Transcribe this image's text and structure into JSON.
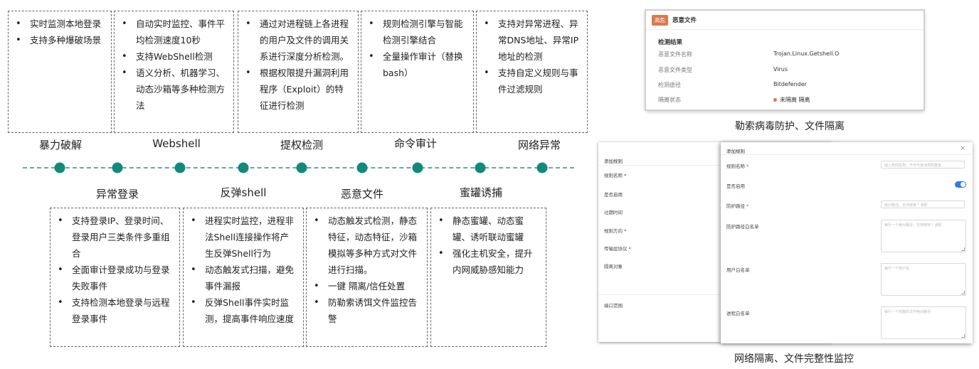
{
  "timeline_top": {
    "labels": [
      "暴力破解",
      "Webshell",
      "提权检测",
      "命令审计",
      "网络异常"
    ],
    "boxes": [
      [
        "实时监测本地登录",
        "支持多种爆破场景"
      ],
      [
        "自动实时监控、事件平均检测速度10秒",
        "支持WebShell检测",
        "语义分析、机器学习、动态沙箱等多种检测方法"
      ],
      [
        "通过对进程链上各进程的用户及文件的调用关系进行深度分析检测。",
        "根据权限提升漏洞利用程序（Exploit）的特征进行检测"
      ],
      [
        "规则检测引擎与智能检测引擎结合",
        "全量操作审计（替换bash）"
      ],
      [
        "支持对异常进程、异常DNS地址、异常IP地址的检测",
        "支持自定义规则与事件过滤规则"
      ]
    ]
  },
  "timeline_bottom": {
    "labels": [
      "异常登录",
      "反弹shell",
      "恶意文件",
      "蜜罐诱捕"
    ],
    "boxes": [
      [
        "支持登录IP、登录时间、登录用户三类条件多重组合",
        "全面审计登录成功与登录失败事件",
        "支持检测本地登录与远程登录事件"
      ],
      [
        "进程实时监控，进程非法Shell连接操作将产生反弹Shell行为",
        "动态触发式扫描，避免事件漏报",
        "反弹Shell事件实时监测，提高事件响应速度"
      ],
      [
        "动态触发式检测，静态特征，动态特征，沙箱模拟等多种方式对文件进行扫描。",
        "一键 隔离/信任处置",
        "防勒索诱饵文件监控告警"
      ],
      [
        "静态蜜罐、动态蜜罐、诱听联动蜜罐",
        "强化主机安全，提升内网威胁感知能力"
      ]
    ]
  },
  "malware_panel": {
    "badge": "高危",
    "title": "恶意文件",
    "section": "检测结果",
    "rows": [
      {
        "label": "恶意文件名称",
        "value": "Trojan.Linux.Getshell.O"
      },
      {
        "label": "恶意文件类型",
        "value": "Virus"
      },
      {
        "label": "检测途径",
        "value": "Bitdefender"
      },
      {
        "label": "隔离状态",
        "value": "未隔离  隔离"
      }
    ],
    "caption": "勒索病毒防护、文件隔离"
  },
  "rule_dialog": {
    "back_title": "添加规则",
    "back_fields": [
      "规则名称 *",
      "是否启用",
      "过期时间",
      "规则方向 *",
      "传输层协议 *",
      "隔离对象",
      "端口范围"
    ],
    "front_title": "添加规则",
    "close": "×",
    "fields": [
      {
        "label": "规则名称",
        "required": "*",
        "placeholder": "输入规则名称，不可与其他规则重复..."
      },
      {
        "label": "是否启用",
        "required": "",
        "placeholder": ""
      },
      {
        "label": "防护路径",
        "required": "*",
        "placeholder": "绝对路径，支持使用 * 通配"
      },
      {
        "label": "防护路径白名单",
        "required": "",
        "placeholder": "每行一个绝对路径，支持使用 * 通配"
      },
      {
        "label": "用户白名单",
        "required": "",
        "placeholder": "每行一个用户名"
      },
      {
        "label": "进程白名单",
        "required": "",
        "placeholder": "每行一个完整的文件绝对路径"
      }
    ],
    "caption": "网络隔离、文件完整性监控"
  },
  "colors": {
    "accent": "#128a7b",
    "badge": "#d9794e",
    "toggle": "#2a7fe0"
  }
}
